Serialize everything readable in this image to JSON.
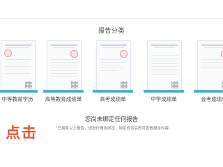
{
  "section_title": "报告分类",
  "reports": [
    {
      "label": "中等教育学历"
    },
    {
      "label": "高等教育成绩单"
    },
    {
      "label": "高考成绩单"
    },
    {
      "label": "中学成绩单"
    },
    {
      "label": "会考成绩单"
    }
  ],
  "empty_state": {
    "title": "您尚未绑定任何报告",
    "description": "\"已拥有以上报告，请进行报告绑定，绑定成功后即可查看报告内容。"
  },
  "promo_text": "点击",
  "colors": {
    "shelf": "#2a9ec0",
    "stamp": "#e77878",
    "promo": "#e8572f"
  }
}
